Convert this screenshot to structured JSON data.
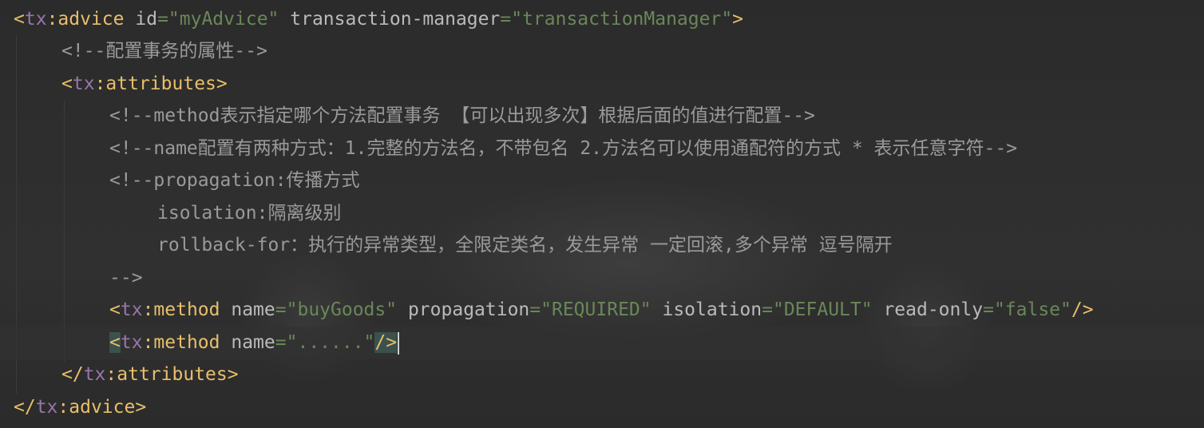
{
  "lines": [
    {
      "t1": "<",
      "ns": "tx",
      "colon": ":",
      "tag": "advice",
      "a1": " id",
      "eq1": "=",
      "v1": "\"myAdvice\"",
      "a2": " transaction-manager",
      "eq2": "=",
      "v2": "\"transactionManager\"",
      "end": ">"
    },
    {
      "comment": "<!--配置事务的属性-->"
    },
    {
      "t1": "<",
      "ns": "tx",
      "colon": ":",
      "tag": "attributes",
      "end": ">"
    },
    {
      "comment": "<!--method表示指定哪个方法配置事务 【可以出现多次】根据后面的值进行配置-->"
    },
    {
      "comment": "<!--name配置有两种方式：1.完整的方法名，不带包名 2.方法名可以使用通配符的方式 * 表示任意字符-->"
    },
    {
      "comment": "<!--propagation:传播方式"
    },
    {
      "comment": "isolation:隔离级别"
    },
    {
      "comment": "rollback-for：执行的异常类型，全限定类名，发生异常 一定回滚,多个异常 逗号隔开"
    },
    {
      "comment": "-->"
    },
    {
      "t1": "<",
      "ns": "tx",
      "colon": ":",
      "tag": "method",
      "a1": " name",
      "eq1": "=",
      "v1": "\"buyGoods\"",
      "a2": " propagation",
      "eq2": "=",
      "v2": "\"REQUIRED\"",
      "a3": " isolation",
      "eq3": "=",
      "v3": "\"DEFAULT\"",
      "a4": " read-only",
      "eq4": "=",
      "v4": "\"false\"",
      "end": "/>"
    },
    {
      "t1": "<",
      "ns": "tx",
      "colon": ":",
      "tag": "method",
      "a1": " name",
      "eq1": "=",
      "v1": "\"......\"",
      "end": "/>"
    },
    {
      "t1": "</",
      "ns": "tx",
      "colon": ":",
      "tag": "attributes",
      "end": ">"
    },
    {
      "t1": "</",
      "ns": "tx",
      "colon": ":",
      "tag": "advice",
      "end": ">"
    }
  ],
  "colors": {
    "background": "#2b2b2b",
    "tag": "#e8bf6a",
    "namespace": "#9876aa",
    "attribute": "#bababa",
    "string": "#6a8759",
    "comment": "#9a9a9a",
    "bracket_highlight": "#3b514d"
  }
}
